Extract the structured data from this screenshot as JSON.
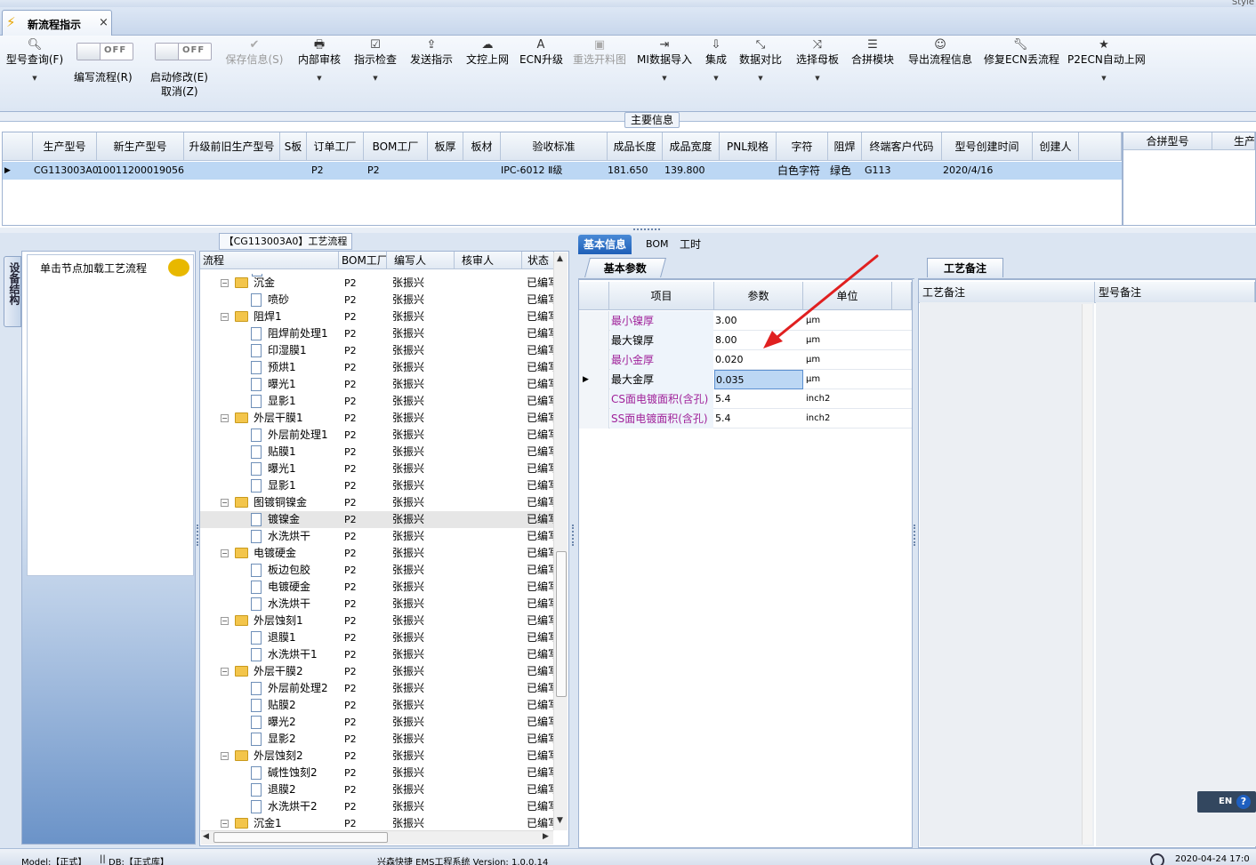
{
  "window": {
    "style_label": "Style",
    "doc_tab_title": "新流程指示",
    "close_glyph": "×"
  },
  "toolbar": {
    "query": "型号查询(F)",
    "write_flow": "编写流程(R)",
    "enable_edit": "启动修改(E)",
    "cancel": "取消(Z)",
    "toggle_off": "OFF",
    "save_info": "保存信息(S)",
    "internal_review": "内部审核",
    "instruction_check": "指示检查",
    "send_instruction": "发送指示",
    "doc_online": "文控上网",
    "ecn_upgrade": "ECN升级",
    "reselect_material": "重选开料图",
    "mi_import": "MI数据导入",
    "integrate": "集成",
    "data_compare": "数据对比",
    "select_mother": "选择母板",
    "merge_module": "合拼模块",
    "export_flow": "导出流程信息",
    "repair_ecn": "修复ECN丢流程",
    "p2ecn": "P2ECN自动上网"
  },
  "main_info": {
    "title": "主要信息",
    "columns": [
      "生产型号",
      "新生产型号",
      "升级前旧生产型号",
      "S板",
      "订单工厂",
      "BOM工厂",
      "板厚",
      "板材",
      "验收标准",
      "成品长度",
      "成品宽度",
      "PNL规格",
      "字符",
      "阻焊",
      "终端客户代码",
      "型号创建时间",
      "创建人"
    ],
    "row": {
      "prod_model": "CG113003A0",
      "new_model": "10011200019056",
      "order_factory": "P2",
      "bom_factory": "P2",
      "standard": "IPC-6012 Ⅱ级",
      "length": "181.650",
      "width": "139.800",
      "char": "白色字符",
      "solder": "绿色",
      "customer": "G113",
      "created": "2020/4/16"
    },
    "side_columns": [
      "合拼型号",
      "生产"
    ]
  },
  "left": {
    "vtab": "设备结构",
    "hint": "单击节点加载工艺流程"
  },
  "tree": {
    "title": "【CG113003A0】工艺流程",
    "columns": [
      "流程",
      "BOM工厂",
      "编写人",
      "核审人",
      "状态"
    ],
    "rows": [
      {
        "name": "沉金",
        "lvl": 0,
        "bom": "P2",
        "by": "张振兴",
        "st": "已编写"
      },
      {
        "name": "喷砂",
        "lvl": 1,
        "bom": "P2",
        "by": "张振兴",
        "st": "已编写"
      },
      {
        "name": "阻焊1",
        "lvl": 0,
        "bom": "P2",
        "by": "张振兴",
        "st": "已编写"
      },
      {
        "name": "阻焊前处理1",
        "lvl": 1,
        "bom": "P2",
        "by": "张振兴",
        "st": "已编写"
      },
      {
        "name": "印湿膜1",
        "lvl": 1,
        "bom": "P2",
        "by": "张振兴",
        "st": "已编写"
      },
      {
        "name": "预烘1",
        "lvl": 1,
        "bom": "P2",
        "by": "张振兴",
        "st": "已编写"
      },
      {
        "name": "曝光1",
        "lvl": 1,
        "bom": "P2",
        "by": "张振兴",
        "st": "已编写"
      },
      {
        "name": "显影1",
        "lvl": 1,
        "bom": "P2",
        "by": "张振兴",
        "st": "已编写"
      },
      {
        "name": "外层干膜1",
        "lvl": 0,
        "bom": "P2",
        "by": "张振兴",
        "st": "已编写"
      },
      {
        "name": "外层前处理1",
        "lvl": 1,
        "bom": "P2",
        "by": "张振兴",
        "st": "已编写"
      },
      {
        "name": "贴膜1",
        "lvl": 1,
        "bom": "P2",
        "by": "张振兴",
        "st": "已编写"
      },
      {
        "name": "曝光1",
        "lvl": 1,
        "bom": "P2",
        "by": "张振兴",
        "st": "已编写"
      },
      {
        "name": "显影1",
        "lvl": 1,
        "bom": "P2",
        "by": "张振兴",
        "st": "已编写"
      },
      {
        "name": "图镀铜镍金",
        "lvl": 0,
        "bom": "P2",
        "by": "张振兴",
        "st": "已编写"
      },
      {
        "name": "镀镍金",
        "lvl": 1,
        "bom": "P2",
        "by": "张振兴",
        "st": "已编写",
        "sel": true
      },
      {
        "name": "水洗烘干",
        "lvl": 1,
        "bom": "P2",
        "by": "张振兴",
        "st": "已编写"
      },
      {
        "name": "电镀硬金",
        "lvl": 0,
        "bom": "P2",
        "by": "张振兴",
        "st": "已编写"
      },
      {
        "name": "板边包胶",
        "lvl": 1,
        "bom": "P2",
        "by": "张振兴",
        "st": "已编写"
      },
      {
        "name": "电镀硬金",
        "lvl": 1,
        "bom": "P2",
        "by": "张振兴",
        "st": "已编写"
      },
      {
        "name": "水洗烘干",
        "lvl": 1,
        "bom": "P2",
        "by": "张振兴",
        "st": "已编写"
      },
      {
        "name": "外层蚀刻1",
        "lvl": 0,
        "bom": "P2",
        "by": "张振兴",
        "st": "已编写"
      },
      {
        "name": "退膜1",
        "lvl": 1,
        "bom": "P2",
        "by": "张振兴",
        "st": "已编写"
      },
      {
        "name": "水洗烘干1",
        "lvl": 1,
        "bom": "P2",
        "by": "张振兴",
        "st": "已编写"
      },
      {
        "name": "外层干膜2",
        "lvl": 0,
        "bom": "P2",
        "by": "张振兴",
        "st": "已编写"
      },
      {
        "name": "外层前处理2",
        "lvl": 1,
        "bom": "P2",
        "by": "张振兴",
        "st": "已编写"
      },
      {
        "name": "贴膜2",
        "lvl": 1,
        "bom": "P2",
        "by": "张振兴",
        "st": "已编写"
      },
      {
        "name": "曝光2",
        "lvl": 1,
        "bom": "P2",
        "by": "张振兴",
        "st": "已编写"
      },
      {
        "name": "显影2",
        "lvl": 1,
        "bom": "P2",
        "by": "张振兴",
        "st": "已编写"
      },
      {
        "name": "外层蚀刻2",
        "lvl": 0,
        "bom": "P2",
        "by": "张振兴",
        "st": "已编写"
      },
      {
        "name": "碱性蚀刻2",
        "lvl": 1,
        "bom": "P2",
        "by": "张振兴",
        "st": "已编写"
      },
      {
        "name": "退膜2",
        "lvl": 1,
        "bom": "P2",
        "by": "张振兴",
        "st": "已编写"
      },
      {
        "name": "水洗烘干2",
        "lvl": 1,
        "bom": "P2",
        "by": "张振兴",
        "st": "已编写"
      },
      {
        "name": "沉金1",
        "lvl": 0,
        "bom": "P2",
        "by": "张振兴",
        "st": "已编写"
      }
    ]
  },
  "right": {
    "tabs": [
      "基本信息",
      "BOM",
      "工时"
    ],
    "sub_tab": "基本参数",
    "columns": [
      "项目",
      "参数",
      "单位"
    ],
    "params": [
      {
        "name": "最小镍厚",
        "value": "3.00",
        "unit": "μm",
        "color": "#a0229a"
      },
      {
        "name": "最大镍厚",
        "value": "8.00",
        "unit": "μm",
        "color": "#000000"
      },
      {
        "name": "最小金厚",
        "value": "0.020",
        "unit": "μm",
        "color": "#a0229a"
      },
      {
        "name": "最大金厚",
        "value": "0.035",
        "unit": "μm",
        "color": "#000000",
        "current": true
      },
      {
        "name": "CS面电镀面积(含孔)",
        "value": "5.4",
        "unit": "inch2",
        "color": "#a0229a"
      },
      {
        "name": "SS面电镀面积(含孔)",
        "value": "5.4",
        "unit": "inch2",
        "color": "#a0229a"
      }
    ],
    "remarks_tab": "工艺备注",
    "remarks_cols": [
      "工艺备注",
      "型号备注"
    ],
    "lang": "EN",
    "help": "?"
  },
  "status": {
    "model": "Model:【正式】",
    "db": "DB:【正式库】",
    "product": "兴森快捷 EMS工程系统 Version: 1.0.0.14",
    "datetime": "2020-04-24 17:0"
  },
  "colors": {
    "accent": "#1e5fb8",
    "selection": "#bcd7f4",
    "annotation_arrow": "#e02020"
  }
}
